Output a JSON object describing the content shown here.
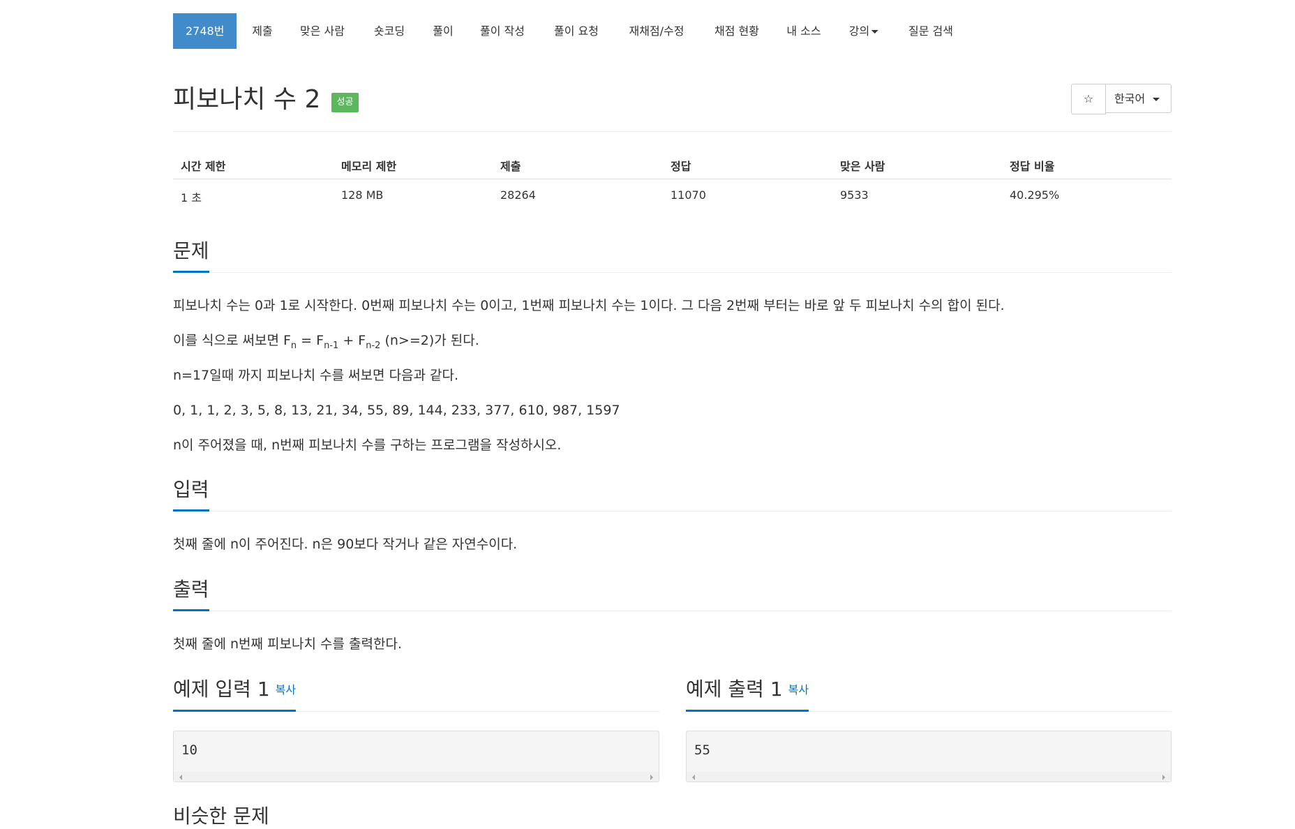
{
  "nav": {
    "items": [
      {
        "label": "2748번"
      },
      {
        "label": "제출"
      },
      {
        "label": "맞은 사람"
      },
      {
        "label": "숏코딩"
      },
      {
        "label": "풀이"
      },
      {
        "label": "풀이 작성"
      },
      {
        "label": "풀이 요청"
      },
      {
        "label": "재채점/수정"
      },
      {
        "label": "채점 현황"
      },
      {
        "label": "내 소스"
      },
      {
        "label": "강의"
      },
      {
        "label": "질문 검색"
      }
    ]
  },
  "problem": {
    "title": "피보나치 수 2",
    "badge": "성공",
    "star": "☆",
    "language": "한국어"
  },
  "info": {
    "headers": [
      "시간 제한",
      "메모리 제한",
      "제출",
      "정답",
      "맞은 사람",
      "정답 비율"
    ],
    "values": [
      "1 초",
      "128 MB",
      "28264",
      "11070",
      "9533",
      "40.295%"
    ]
  },
  "sections": {
    "problem_title": "문제",
    "problem_p1": "피보나치 수는 0과 1로 시작한다. 0번째 피보나치 수는 0이고, 1번째 피보나치 수는 1이다. 그 다음 2번째 부터는 바로 앞 두 피보나치 수의 합이 된다.",
    "problem_p2_pre": "이를 식으로 써보면 F",
    "problem_p2_sub1": "n",
    "problem_p2_mid1": " = F",
    "problem_p2_sub2": "n-1",
    "problem_p2_mid2": " + F",
    "problem_p2_sub3": "n-2",
    "problem_p2_post": " (n>=2)가 된다.",
    "problem_p3": "n=17일때 까지 피보나치 수를 써보면 다음과 같다.",
    "problem_p4": "0, 1, 1, 2, 3, 5, 8, 13, 21, 34, 55, 89, 144, 233, 377, 610, 987, 1597",
    "problem_p5": "n이 주어졌을 때, n번째 피보나치 수를 구하는 프로그램을 작성하시오.",
    "input_title": "입력",
    "input_p": "첫째 줄에 n이 주어진다. n은 90보다 작거나 같은 자연수이다.",
    "output_title": "출력",
    "output_p": "첫째 줄에 n번째 피보나치 수를 출력한다."
  },
  "samples": {
    "input_title": "예제 입력 1",
    "output_title": "예제 출력 1",
    "copy_label": "복사",
    "input_value": "10",
    "output_value": "55"
  },
  "next_section_title": "비슷한 문제"
}
